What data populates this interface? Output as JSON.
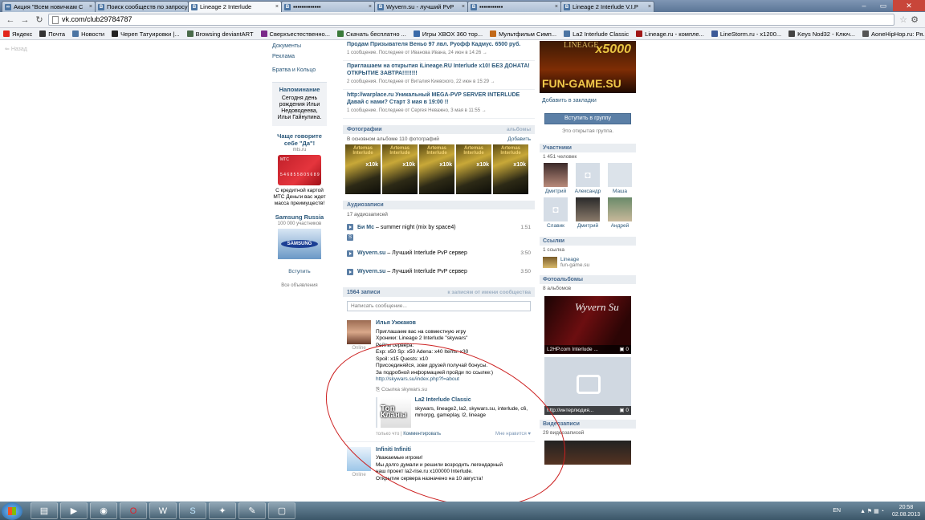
{
  "browser": {
    "tabs": [
      {
        "label": "Акция \"Всем новичкам С",
        "active": false
      },
      {
        "label": "Поиск сообществ по запросу",
        "active": false
      },
      {
        "label": "Lineage 2 Interlude",
        "active": true
      },
      {
        "label": "▪▪▪▪▪▪▪▪▪▪▪▪▪",
        "active": false
      },
      {
        "label": "Wyvern.su - лучший PvP",
        "active": false
      },
      {
        "label": "▪▪▪▪▪▪▪▪▪▪▪",
        "active": false
      },
      {
        "label": "Lineage 2 Interlude V.I.P",
        "active": false
      }
    ],
    "url": "vk.com/club29784787",
    "bookmarks": [
      {
        "label": "Яндекс",
        "icon": "yandex-icon",
        "color": "#e2261c"
      },
      {
        "label": "Почта",
        "icon": "mail-icon",
        "color": "#333333"
      },
      {
        "label": "Новости",
        "icon": "vk-icon",
        "color": "#4c75a3"
      },
      {
        "label": "Череп Татуировки |...",
        "icon": "skull-icon",
        "color": "#222222"
      },
      {
        "label": "Browsing deviantART",
        "icon": "deviantart-icon",
        "color": "#4a6b4a"
      },
      {
        "label": "Сверхъестественно...",
        "icon": "lf-icon",
        "color": "#7a2a8a"
      },
      {
        "label": "Скачать бесплатно ...",
        "icon": "download-icon",
        "color": "#3a7a3a"
      },
      {
        "label": "Игры XBOX 360 тор...",
        "icon": "globe-icon",
        "color": "#3a6aa8"
      },
      {
        "label": "Мультфильм Симп...",
        "icon": "film-icon",
        "color": "#c26a1a"
      },
      {
        "label": "La2 Interlude Classic",
        "icon": "vk-icon",
        "color": "#4c75a3"
      },
      {
        "label": "Lineage.ru - компле...",
        "icon": "lineage-icon",
        "color": "#a01818"
      },
      {
        "label": "LineStorm.ru - x1200...",
        "icon": "facebook-icon",
        "color": "#3b5998"
      },
      {
        "label": "Keys Nod32 - Ключ...",
        "icon": "key-icon",
        "color": "#444444"
      },
      {
        "label": "AoneHipHop.ru: Ря...",
        "icon": "page-icon",
        "color": "#555555"
      }
    ]
  },
  "page": {
    "back_link": "Назад",
    "left": {
      "links": [
        "Документы",
        "Реклама",
        "Братва и Кольцо"
      ],
      "reminder": {
        "title": "Напоминание",
        "text": "Сегодня день рождения Ильи Недоводеева, Ильи Гайнулина."
      },
      "ad1": {
        "title": "Чаще говорите себе \"Да\"!",
        "site": "mts.ru",
        "text": "С кредитной картой МТС Деньги вас ждет масса преимуществ!",
        "card_label": "МТС",
        "card_number": "5 4 6 8 5 5 8 0 5 6 8 9"
      },
      "ad2": {
        "title": "Samsung Russia",
        "subtitle": "100 000 участников",
        "logo": "SAMSUNG",
        "join": "Вступить"
      },
      "all_ads": "Все объявления"
    },
    "discussions": [
      {
        "title": "Продам Призывателя Веньо 97 лвл. Руофф Кадмус. 6500 руб.",
        "meta": "1 сообщение. Последнее от Иванова Ивана, 24 июн в 14:26 →"
      },
      {
        "title": "Приглашаем на открытия iLineage.RU Interlude x10! БЕЗ ДОНАТА! ОТКРЫТИЕ ЗАВТРА!!!!!!!!",
        "meta": "2 сообщения. Последнее от Виталия Киевского, 22 июн в 15:29 →"
      },
      {
        "title": "http://warplace.ru Уникальный MEGA-PVP SERVER INTERLUDE Давай с нами? Старт 3 мая в 19:00 !!",
        "meta": "1 сообщение. Последнее от Сергея Неважно, 3 мая в 11:55 →"
      }
    ],
    "photos": {
      "title": "Фотографии",
      "albums_link": "альбомы",
      "count_text": "В основном альбоме 110 фотографий",
      "add_link": "Добавить",
      "thumb_title": "Artemas Interlude",
      "thumb_rate": "x10k"
    },
    "audio": {
      "title": "Аудиозаписи",
      "count_text": "17 аудиозаписей",
      "tracks": [
        {
          "artist": "Би Mc",
          "title": "summer night (mix by space4)",
          "duration": "1:51"
        },
        {
          "artist": "Wyvern.su",
          "title": "Лучший Interlude PvP сервер",
          "duration": "3:50"
        },
        {
          "artist": "Wyvern.su",
          "title": "Лучший Interlude PvP сервер",
          "duration": "3:50"
        }
      ],
      "s_badge": "S"
    },
    "wall": {
      "title": "1564 записи",
      "link": "к записям от имени сообщества",
      "placeholder": "Написать сообщение...",
      "posts": [
        {
          "author": "Илья Ужжаков",
          "status": "Online",
          "lines": [
            "Приглашаем вас на совместную игру",
            "Хроники: Lineage 2 Interlude \"skywars\"",
            "Рейты сервера:",
            "Exp: x50 Sp: x50 Adena: x40 Items: x30",
            "Spoil: x15 Quests: x10",
            "Присоединяйся, зови друзей получай бонусы.",
            "За подробной информацией пройди по ссылке:)"
          ],
          "link": "http://skywars.su/index.php?f=about",
          "share": "Ссылка skywars.su",
          "attach_title": "La2 Interlude Classic",
          "attach_thumb": "Топ Кланы",
          "attach_text": "skywars, lineage2, la2, skywars.su, interlude, c6, mmorpg, gameplay, l2, lineage",
          "time": "только что",
          "comment": "Комментировать",
          "like": "Мне нравится ♥"
        },
        {
          "author": "Infiniti Infiniti",
          "status": "Online",
          "lines": [
            "Уважаемые игроки!",
            "Мы долго думали и решили возродить легендарный",
            "наш проект la2-rise.ru x100000 Interlude.",
            "Открытие сервера назначено на 10 августа!"
          ]
        }
      ]
    },
    "right": {
      "banner": {
        "top": "LINEAGE",
        "rate": "x5000",
        "bottom": "FUN-GAME.SU"
      },
      "add_bookmark": "Добавить в закладки",
      "join_button": "Вступить в группу",
      "open_group": "Это открытая группа.",
      "members": {
        "title": "Участники",
        "count": "1 451 человек",
        "list": [
          "Дмитрий",
          "Александр",
          "Маша",
          "Славик",
          "Дмитрий",
          "Андрей"
        ]
      },
      "links": {
        "title": "Ссылки",
        "count": "1 ссылка",
        "item_title": "Lineage",
        "item_site": "fun-game.su"
      },
      "albums": {
        "title": "Фотоальбомы",
        "count": "8 альбомов",
        "a1_caption": "L2HP.com Interlude ...",
        "a1_count": "0",
        "a1_art": "Wyvern Su",
        "a2_caption": "http://интерлюдия...",
        "a2_count": "0"
      },
      "videos": {
        "title": "Видеозаписи",
        "count": "29 видеозаписей"
      }
    }
  },
  "taskbar": {
    "apps": [
      "folder-icon",
      "media-icon",
      "chrome-icon",
      "opera-icon",
      "word-icon",
      "skype-icon",
      "game-icon",
      "paint-icon",
      "window-icon"
    ],
    "lang": "EN",
    "time": "20:58",
    "date": "02.08.2013"
  },
  "colors": {
    "vk_link": "#2b587a",
    "vk_header": "#45688e",
    "vk_button": "#5b7fa6",
    "annotation": "#cc1f1f"
  }
}
